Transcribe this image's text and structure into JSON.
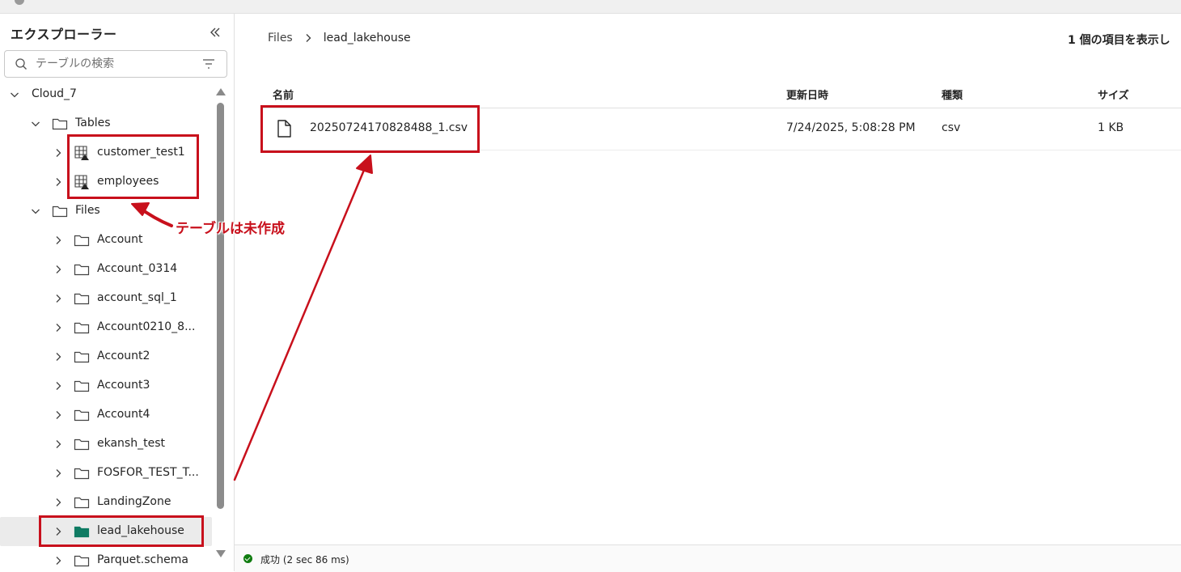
{
  "explorer": {
    "title": "エクスプローラー",
    "search_placeholder": "テーブルの検索",
    "tree": {
      "root": "Cloud_7",
      "tables_folder": "Tables",
      "tables": [
        "customer_test1",
        "employees"
      ],
      "files_folder": "Files",
      "files": [
        "Account",
        "Account_0314",
        "account_sql_1",
        "Account0210_8...",
        "Account2",
        "Account3",
        "Account4",
        "ekansh_test",
        "FOSFOR_TEST_T...",
        "LandingZone",
        "lead_lakehouse",
        "Parquet.schema"
      ],
      "selected": "lead_lakehouse"
    }
  },
  "main": {
    "breadcrumb": [
      "Files",
      "lead_lakehouse"
    ],
    "item_count": "1 個の項目を表示し",
    "columns": [
      "名前",
      "更新日時",
      "種類",
      "サイズ"
    ],
    "rows": [
      {
        "name": "20250724170828488_1.csv",
        "modified": "7/24/2025, 5:08:28 PM",
        "type": "csv",
        "size": "1 KB"
      }
    ]
  },
  "status": {
    "text": "成功 (2 sec 86 ms)"
  },
  "annotation": {
    "text": "テーブルは未作成",
    "color": "#c8101c"
  },
  "colors": {
    "selected_folder": "#0f7b63",
    "success": "#107c10"
  }
}
